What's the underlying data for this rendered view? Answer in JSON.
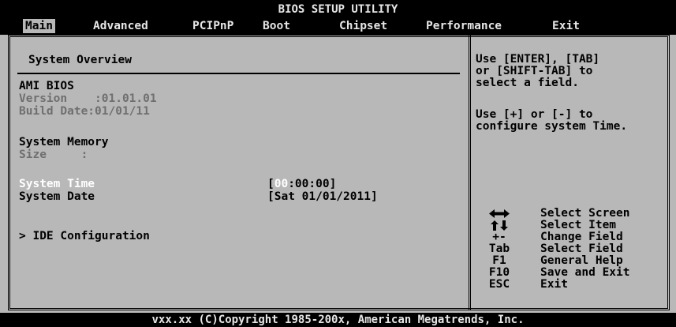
{
  "header": {
    "title": "BIOS SETUP UTILITY",
    "tabs": [
      "Main",
      "Advanced",
      "PCIPnP",
      "Boot",
      "Chipset",
      "Performance",
      "Exit"
    ],
    "active_tab": "Main"
  },
  "main": {
    "section_title": "System Overview",
    "bios": {
      "heading": "AMI BIOS",
      "version_label": "Version    :",
      "version_value": "01.01.01",
      "build_date_label": "Build Date:",
      "build_date_value": "01/01/11"
    },
    "memory": {
      "heading": "System Memory",
      "size_label": "Size     :"
    },
    "system_time": {
      "label": "System Time",
      "value_prefix": "[",
      "value_selected": "00",
      "value_rest": ":00:00]"
    },
    "system_date": {
      "label": "System Date",
      "value": "[Sat 01/01/2011]"
    },
    "submenu": {
      "label": "> IDE Configuration"
    }
  },
  "help": {
    "lines1": [
      "Use [ENTER], [TAB]",
      "or [SHIFT-TAB] to",
      "select a field."
    ],
    "lines2": [
      "Use [+] or [-] to",
      "configure system Time."
    ]
  },
  "keys": [
    {
      "icon": "left-right-arrows-icon",
      "desc": "Select Screen"
    },
    {
      "icon": "up-down-arrows-icon",
      "desc": "Select Item"
    },
    {
      "key": "+-",
      "desc": "Change Field"
    },
    {
      "key": "Tab",
      "desc": "Select Field"
    },
    {
      "key": "F1",
      "desc": "General Help"
    },
    {
      "key": "F10",
      "desc": "Save and Exit"
    },
    {
      "key": "ESC",
      "desc": "Exit"
    }
  ],
  "footer": {
    "text": "vxx.xx (C)Copyright 1985-200x, American Megatrends, Inc."
  },
  "colors": {
    "background": "#b8b8b8",
    "bar": "#000000",
    "dim_text": "#6f6f6f",
    "highlight": "#ffffff"
  }
}
